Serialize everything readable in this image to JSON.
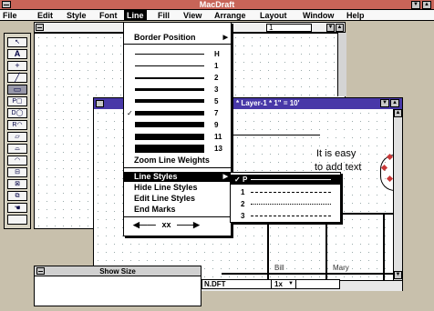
{
  "app": {
    "title": "MacDraft"
  },
  "menubar": [
    {
      "label": "File",
      "id": "file"
    },
    {
      "label": "Edit",
      "id": "edit"
    },
    {
      "label": "Style",
      "id": "style"
    },
    {
      "label": "Font",
      "id": "font"
    },
    {
      "label": "Line",
      "id": "line"
    },
    {
      "label": "Fill",
      "id": "fill"
    },
    {
      "label": "View",
      "id": "view"
    },
    {
      "label": "Arrange",
      "id": "arrange"
    },
    {
      "label": "Layout",
      "id": "layout"
    },
    {
      "label": "Window",
      "id": "window"
    },
    {
      "label": "Help",
      "id": "help"
    }
  ],
  "back_doc": {
    "field_value": "1"
  },
  "line_menu": {
    "border_position": "Border Position",
    "weights": [
      "H",
      "1",
      "2",
      "3",
      "5",
      "7",
      "9",
      "11",
      "13"
    ],
    "checked_weight": "7",
    "zoom_line_weights": "Zoom Line Weights",
    "line_styles": "Line Styles",
    "hide_line_styles": "Hide Line Styles",
    "edit_line_styles": "Edit Line Styles",
    "end_marks": "End Marks",
    "end_marks_sample": "xx"
  },
  "line_styles_submenu": [
    {
      "label": "P",
      "checked": true
    },
    {
      "label": "1"
    },
    {
      "label": "2"
    },
    {
      "label": "3"
    }
  ],
  "front_doc": {
    "title": "* Layer-1 * 1\" = 10'",
    "annotation_line1": "It is easy",
    "annotation_line2": "to add text",
    "label_bill": "Bill",
    "label_mary": "Mary"
  },
  "show_size": {
    "title": "Show Size"
  },
  "statusbar": {
    "filename": "N.DFT",
    "zoom": "1x"
  },
  "colors": {
    "title_bar": "#c86458",
    "doc_title": "#4838a8",
    "highlight": "#000000",
    "accent_red": "#c83838"
  }
}
